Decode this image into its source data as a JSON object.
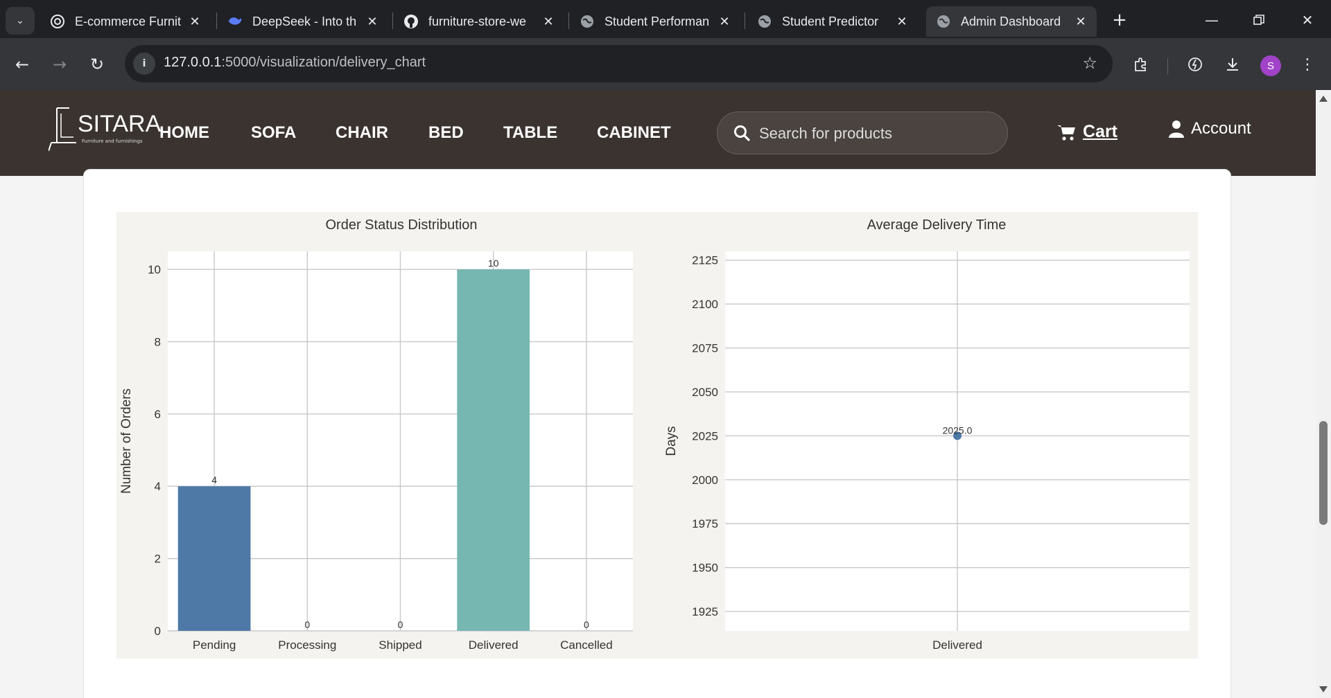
{
  "browser": {
    "tabs": [
      {
        "title": "E-commerce Furnit",
        "icon": "openai-icon"
      },
      {
        "title": "DeepSeek - Into th",
        "icon": "deepseek-icon"
      },
      {
        "title": "furniture-store-we",
        "icon": "github-icon"
      },
      {
        "title": "Student Performan",
        "icon": "globe-icon"
      },
      {
        "title": "Student Predictor",
        "icon": "globe-icon"
      },
      {
        "title": "Admin Dashboard",
        "icon": "globe-icon",
        "active": true
      }
    ],
    "url_host": "127.0.0.1",
    "url_path": ":5000/visualization/delivery_chart",
    "profile_initial": "S",
    "colors": {
      "frame": "#202124",
      "toolbar": "#35363a",
      "profile": "#a142c8"
    }
  },
  "site": {
    "logo_text": "SITARA",
    "logo_sub": "Furniture and furnishings",
    "nav": [
      "HOME",
      "SOFA",
      "CHAIR",
      "BED",
      "TABLE",
      "CABINET"
    ],
    "search_placeholder": "Search for products",
    "cart_label": "Cart",
    "account_label": "Account",
    "colors": {
      "header": "#3a3330"
    }
  },
  "chart_data": [
    {
      "type": "bar",
      "title": "Order Status Distribution",
      "xlabel": "",
      "ylabel": "Number of Orders",
      "categories": [
        "Pending",
        "Processing",
        "Shipped",
        "Delivered",
        "Cancelled"
      ],
      "values": [
        4,
        0,
        0,
        10,
        0
      ],
      "data_labels": [
        "4",
        "0",
        "0",
        "10",
        "0"
      ],
      "ylim": [
        0,
        10.5
      ],
      "yticks": [
        "0",
        "2",
        "4",
        "6",
        "8",
        "10"
      ],
      "colors": [
        "#4e79a7",
        "#4e79a7",
        "#4e79a7",
        "#76b7b2",
        "#76b7b2"
      ],
      "grid": true
    },
    {
      "type": "scatter",
      "title": "Average Delivery Time",
      "xlabel": "",
      "ylabel": "Days",
      "categories": [
        "Delivered"
      ],
      "values": [
        2025.0
      ],
      "data_labels": [
        "2025.0"
      ],
      "ylim": [
        1914,
        2130
      ],
      "yticks": [
        "1925",
        "1950",
        "1975",
        "2000",
        "2025",
        "2050",
        "2075",
        "2100",
        "2125"
      ],
      "colors": [
        "#4e79a7"
      ],
      "grid": true
    }
  ]
}
